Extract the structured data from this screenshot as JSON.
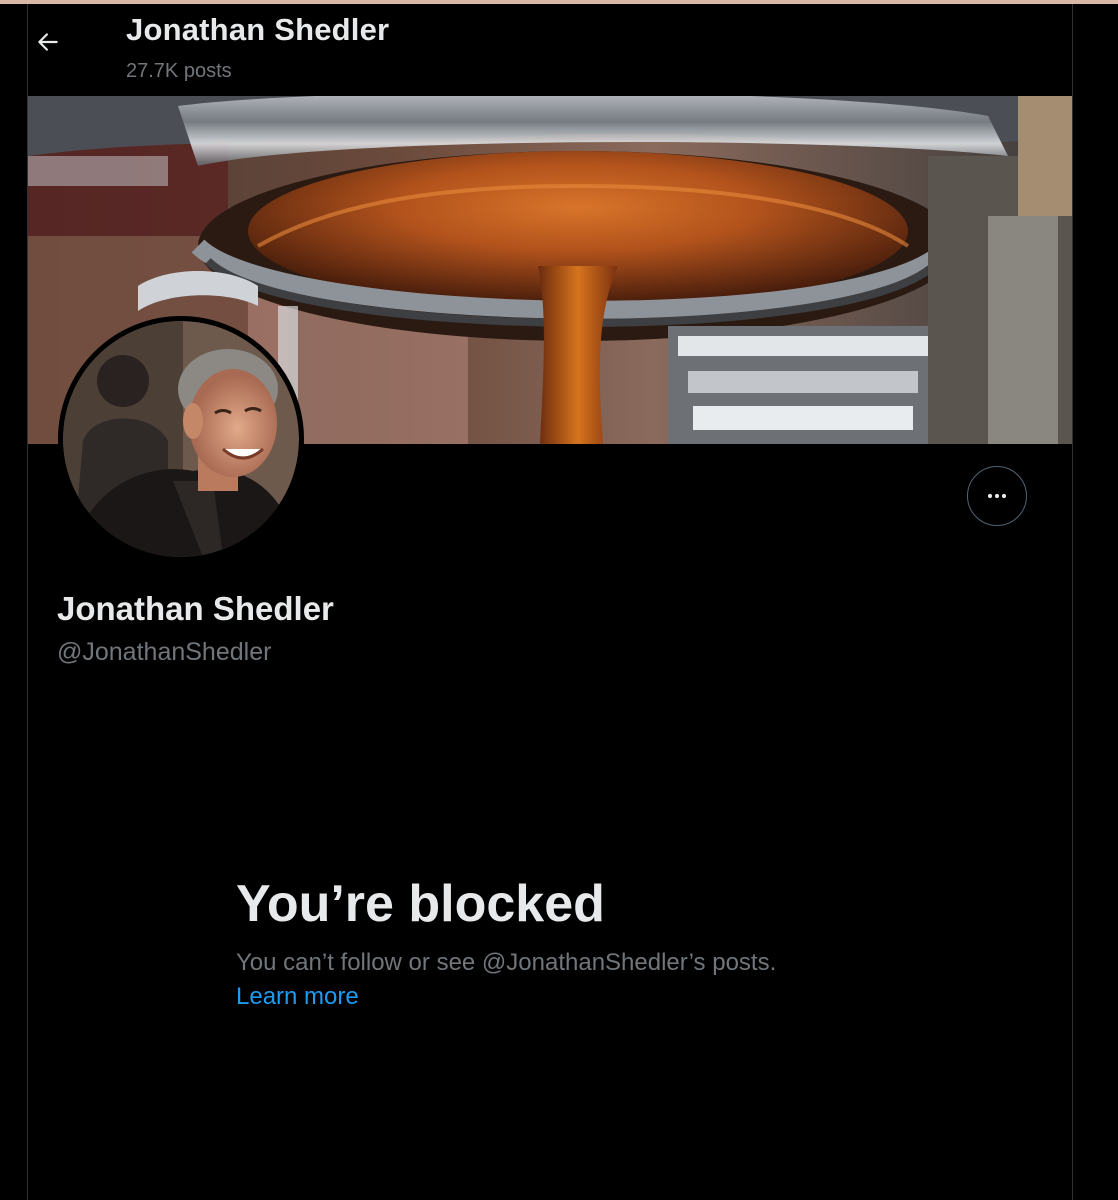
{
  "header": {
    "title": "Jonathan Shedler",
    "posts_count": "27.7K posts"
  },
  "profile": {
    "name": "Jonathan Shedler",
    "handle": "@JonathanShedler"
  },
  "blocked": {
    "title": "You’re blocked",
    "message": "You can’t follow or see @JonathanShedler’s posts.",
    "link": "Learn more"
  },
  "icons": {
    "back": "arrow-left-icon",
    "more": "more-horizontal-icon"
  },
  "colors": {
    "background": "#000000",
    "primary_text": "#e7e9ea",
    "secondary_text": "#71767b",
    "link": "#1d9bf0",
    "border": "#536471"
  }
}
